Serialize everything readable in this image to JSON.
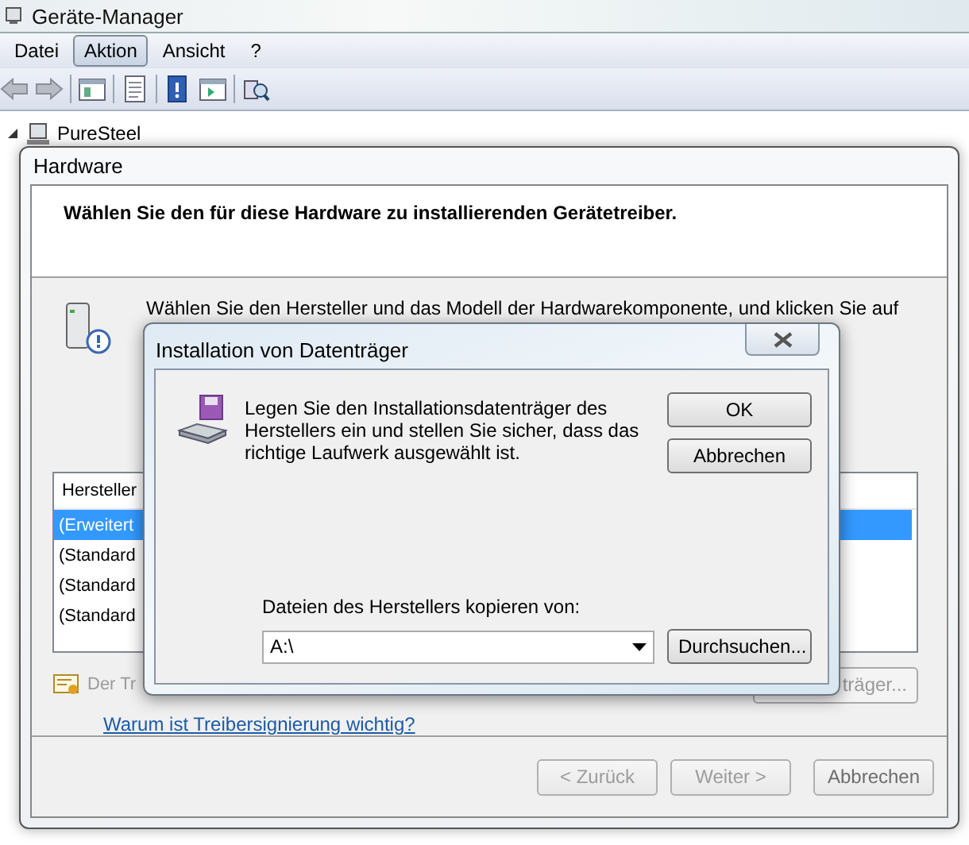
{
  "device_manager": {
    "title": "Geräte-Manager",
    "menu": [
      {
        "label": "Datei",
        "selected": false
      },
      {
        "label": "Aktion",
        "selected": true
      },
      {
        "label": "Ansicht",
        "selected": false
      },
      {
        "label": "?",
        "selected": false
      }
    ],
    "tree": [
      {
        "label": "PureSteel",
        "expanded": true
      }
    ]
  },
  "wizard": {
    "title": "Hardware",
    "heading": "Wählen Sie den für diese Hardware zu installierenden Gerätetreiber.",
    "description": "Wählen Sie den Hersteller und das Modell der Hardwarekomponente, und klicken Sie auf",
    "list": {
      "header": "Hersteller",
      "rows": [
        {
          "label": "(Erweitert",
          "selected": true
        },
        {
          "label": "(Standard",
          "selected": false
        },
        {
          "label": "(Standard",
          "selected": false
        },
        {
          "label": "(Standard",
          "selected": false
        }
      ]
    },
    "signature_note": "Der Tr",
    "disk_button": "träger...",
    "link": "Warum ist Treibersignierung wichtig?",
    "buttons": [
      {
        "label": "< Zurück",
        "disabled": true
      },
      {
        "label": "Weiter >",
        "disabled": true
      },
      {
        "label": "Abbrechen",
        "disabled": false
      }
    ]
  },
  "disk_dialog": {
    "title": "Installation von Datenträger",
    "message": "Legen Sie den Installationsdatenträger des Herstellers ein und stellen Sie sicher, dass das richtige Laufwerk ausgewählt ist.",
    "buttons": [
      "OK",
      "Abbrechen"
    ],
    "source_label": "Dateien des Herstellers kopieren von:",
    "source_value": "A:\\",
    "browse_button": "Durchsuchen..."
  }
}
